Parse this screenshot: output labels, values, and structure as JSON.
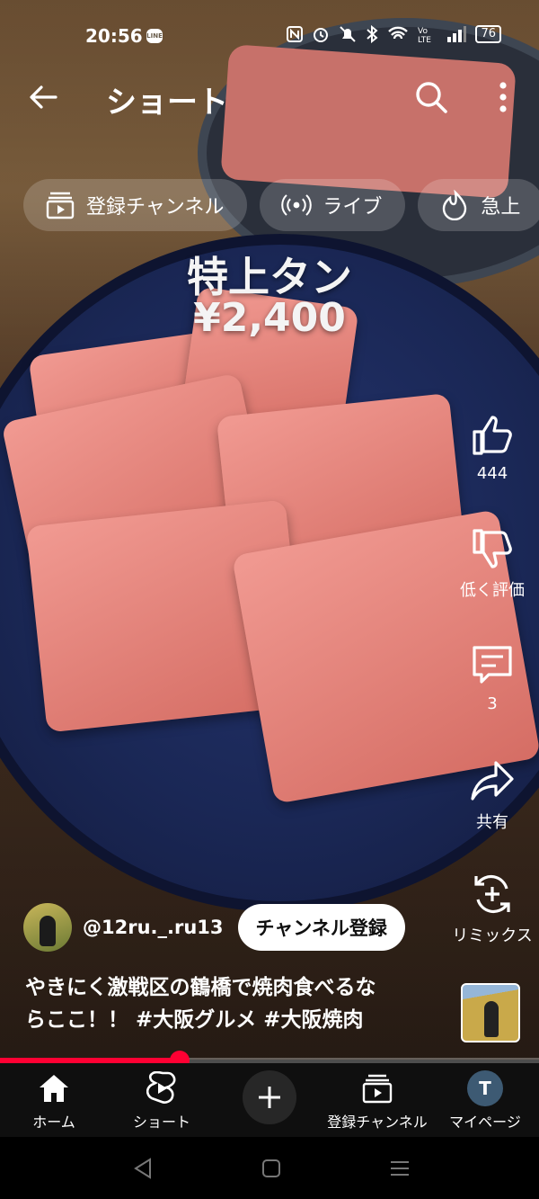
{
  "status_bar": {
    "time": "20:56",
    "battery": "76",
    "notification_app": "LINE",
    "icons": [
      "nfc-icon",
      "alarm-icon",
      "mute-icon",
      "bluetooth-icon",
      "wifi-icon",
      "volte-icon",
      "signal-icon",
      "battery-icon"
    ]
  },
  "appbar": {
    "title": "ショート"
  },
  "chips": [
    {
      "label": "登録チャンネル",
      "icon": "subscriptions-icon"
    },
    {
      "label": "ライブ",
      "icon": "live-icon"
    },
    {
      "label": "急上",
      "icon": "trending-icon"
    }
  ],
  "video_overlay": {
    "title": "特上タン",
    "price": "¥2,400"
  },
  "actions": {
    "like_count": "444",
    "dislike_label": "低く評価",
    "comment_count": "3",
    "share_label": "共有",
    "remix_label": "リミックス"
  },
  "channel": {
    "handle": "@12ru._.ru13",
    "subscribe_label": "チャンネル登録"
  },
  "description": {
    "line1": "やきにく激戦区の鶴橋で焼肉食べるな",
    "line2": "らここ！！ #大阪グルメ #大阪焼肉"
  },
  "progress": {
    "fraction": 0.333
  },
  "bottom_nav": {
    "home": "ホーム",
    "shorts": "ショート",
    "subscriptions": "登録チャンネル",
    "me": "マイページ",
    "avatar_letter": "T"
  },
  "colors": {
    "accent": "#ff0033",
    "nav_bg": "#0f0f0f",
    "chip_bg": "rgba(255,255,255,0.18)"
  }
}
